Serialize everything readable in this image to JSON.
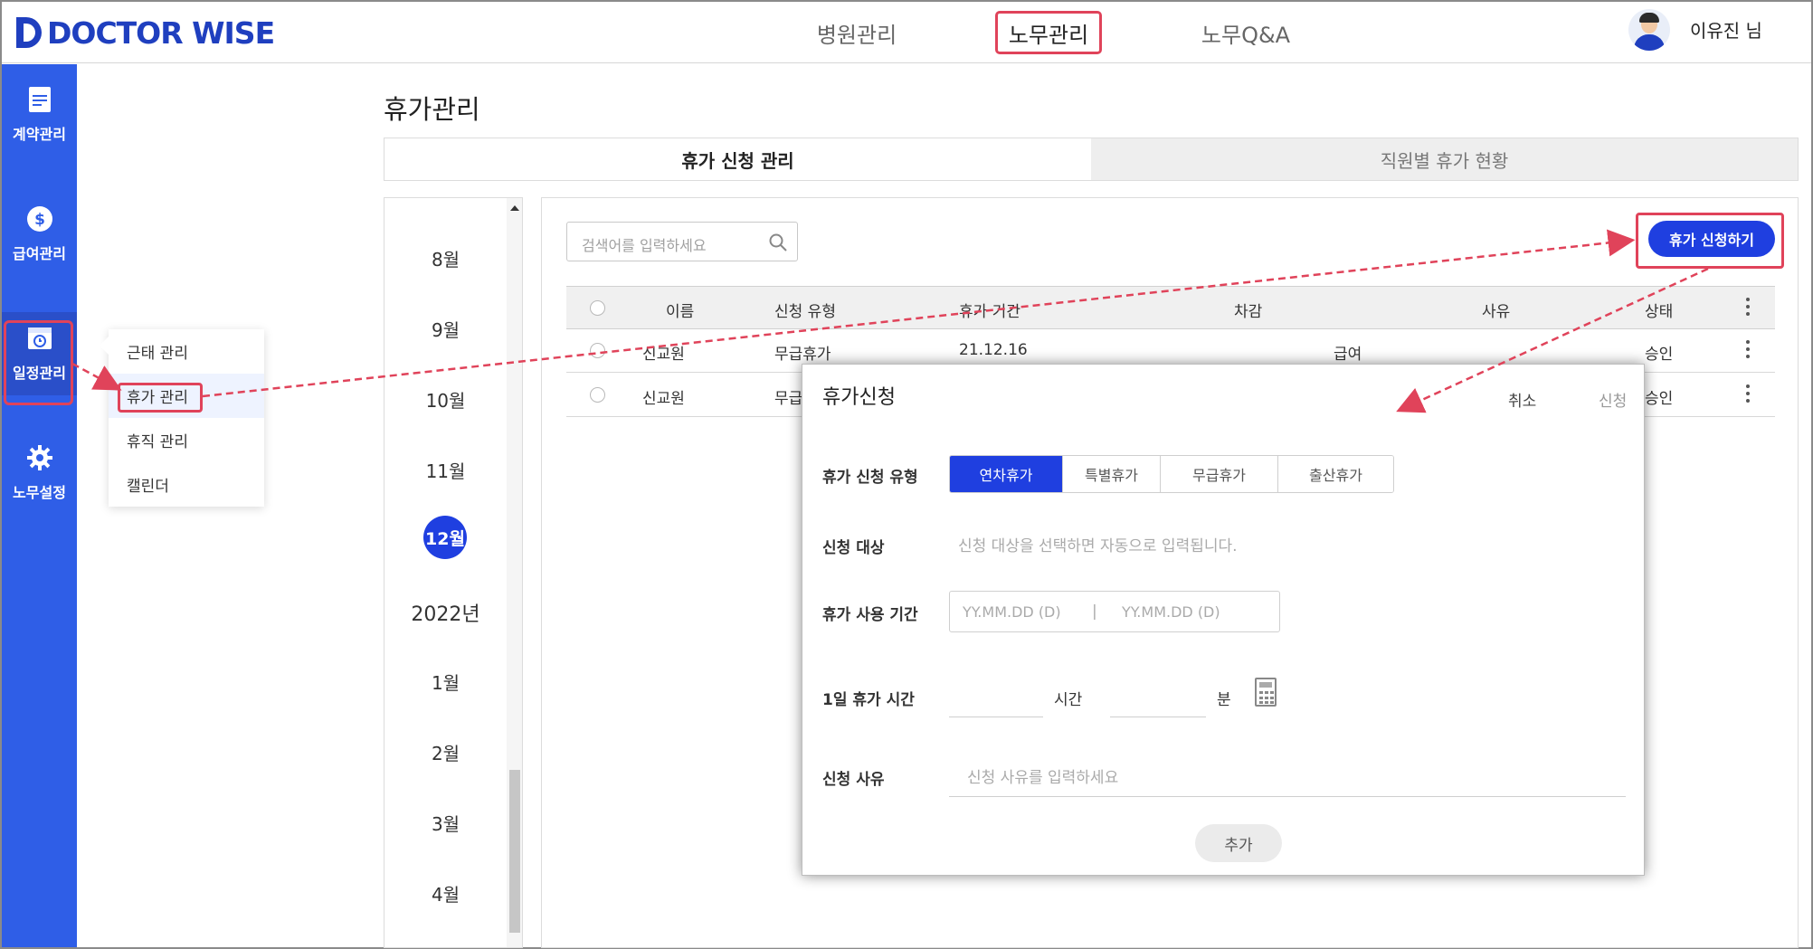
{
  "header": {
    "logo": "DOCTOR WISE",
    "nav": [
      "병원관리",
      "노무관리",
      "노무Q&A"
    ],
    "user": "이유진 님"
  },
  "sidebar": {
    "items": [
      {
        "label": "계약관리",
        "icon": "document-icon"
      },
      {
        "label": "급여관리",
        "icon": "dollar-icon"
      },
      {
        "label": "일정관리",
        "icon": "calendar-clock-icon"
      },
      {
        "label": "노무설정",
        "icon": "gear-icon"
      }
    ]
  },
  "submenu": {
    "items": [
      "근태 관리",
      "휴가 관리",
      "휴직 관리",
      "캘린더"
    ]
  },
  "page": {
    "title": "휴가관리",
    "tabs": [
      "휴가 신청 관리",
      "직원별 휴가 현황"
    ]
  },
  "months": [
    "8월",
    "9월",
    "10월",
    "11월",
    "12월",
    "2022년",
    "1월",
    "2월",
    "3월",
    "4월"
  ],
  "search": {
    "placeholder": "검색어를 입력하세요"
  },
  "apply_button": "휴가 신청하기",
  "table": {
    "headers": [
      "이름",
      "신청 유형",
      "휴가 기간",
      "차감",
      "사유",
      "상태"
    ],
    "rows": [
      {
        "name": "신교원",
        "type": "무급휴가",
        "period": "21.12.16",
        "deduct": "급여",
        "status": "승인"
      },
      {
        "name": "신교원",
        "type": "무급",
        "period": "",
        "deduct": "",
        "status": "승인"
      }
    ]
  },
  "modal": {
    "title": "휴가신청",
    "cancel": "취소",
    "submit": "신청",
    "type_label": "휴가 신청 유형",
    "types": [
      "연차휴가",
      "특별휴가",
      "무급휴가",
      "출산휴가"
    ],
    "target_label": "신청 대상",
    "target_hint": "신청 대상을 선택하면 자동으로 입력됩니다.",
    "period_label": "휴가 사용 기간",
    "date_placeholder": "YY.MM.DD (D)",
    "date_sep": "|",
    "hours_label": "1일 휴가 시간",
    "hour_unit": "시간",
    "minute_unit": "분",
    "reason_label": "신청 사유",
    "reason_placeholder": "신청 사유를 입력하세요",
    "add": "추가"
  },
  "colors": {
    "primary": "#1f3fe0",
    "sidebar": "#2f5ee7",
    "highlight": "#e0435a"
  }
}
